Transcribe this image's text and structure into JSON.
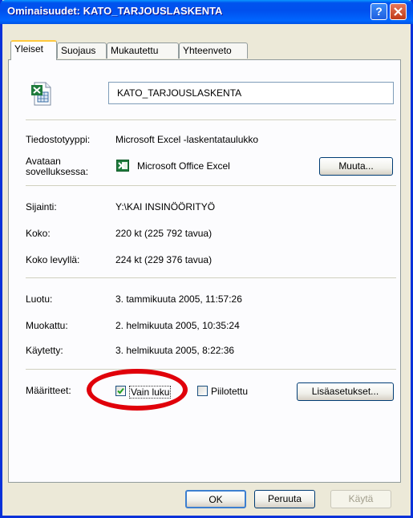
{
  "window": {
    "title": "Ominaisuudet: KATO_TARJOUSLASKENTA"
  },
  "titlebar_buttons": {
    "help": "?"
  },
  "tabs": [
    {
      "label": "Yleiset",
      "active": true
    },
    {
      "label": "Suojaus",
      "active": false
    },
    {
      "label": "Mukautettu",
      "active": false
    },
    {
      "label": "Yhteenveto",
      "active": false
    }
  ],
  "file": {
    "name": "KATO_TARJOUSLASKENTA",
    "icon": "excel-file-icon",
    "type_label": "Tiedostotyyppi:",
    "type_value": "Microsoft Excel -laskentataulukko",
    "opens_with_label_1": "Avataan",
    "opens_with_label_2": "sovelluksessa:",
    "opens_with_value": "Microsoft Office Excel",
    "change_button": "Muuta..."
  },
  "location": {
    "location_label": "Sijainti:",
    "location_value": "Y:\\KAI INSINÖÖRITYÖ",
    "size_label": "Koko:",
    "size_value": "220 kt (225 792 tavua)",
    "size_on_disk_label": "Koko levyllä:",
    "size_on_disk_value": "224 kt (229 376 tavua)"
  },
  "dates": {
    "created_label": "Luotu:",
    "created_value": "3. tammikuuta 2005, 11:57:26",
    "modified_label": "Muokattu:",
    "modified_value": "2. helmikuuta 2005, 10:35:24",
    "accessed_label": "Käytetty:",
    "accessed_value": "3. helmikuuta 2005, 8:22:36"
  },
  "attributes": {
    "label": "Määritteet:",
    "readonly_label": "Vain luku",
    "readonly_checked": true,
    "hidden_label": "Piilotettu",
    "hidden_checked": false,
    "advanced_button": "Lisäasetukset..."
  },
  "buttons": {
    "ok": "OK",
    "cancel": "Peruuta",
    "apply": "Käytä"
  },
  "colors": {
    "highlight_ellipse": "#e0000a",
    "titlebar": "#0053ee"
  }
}
